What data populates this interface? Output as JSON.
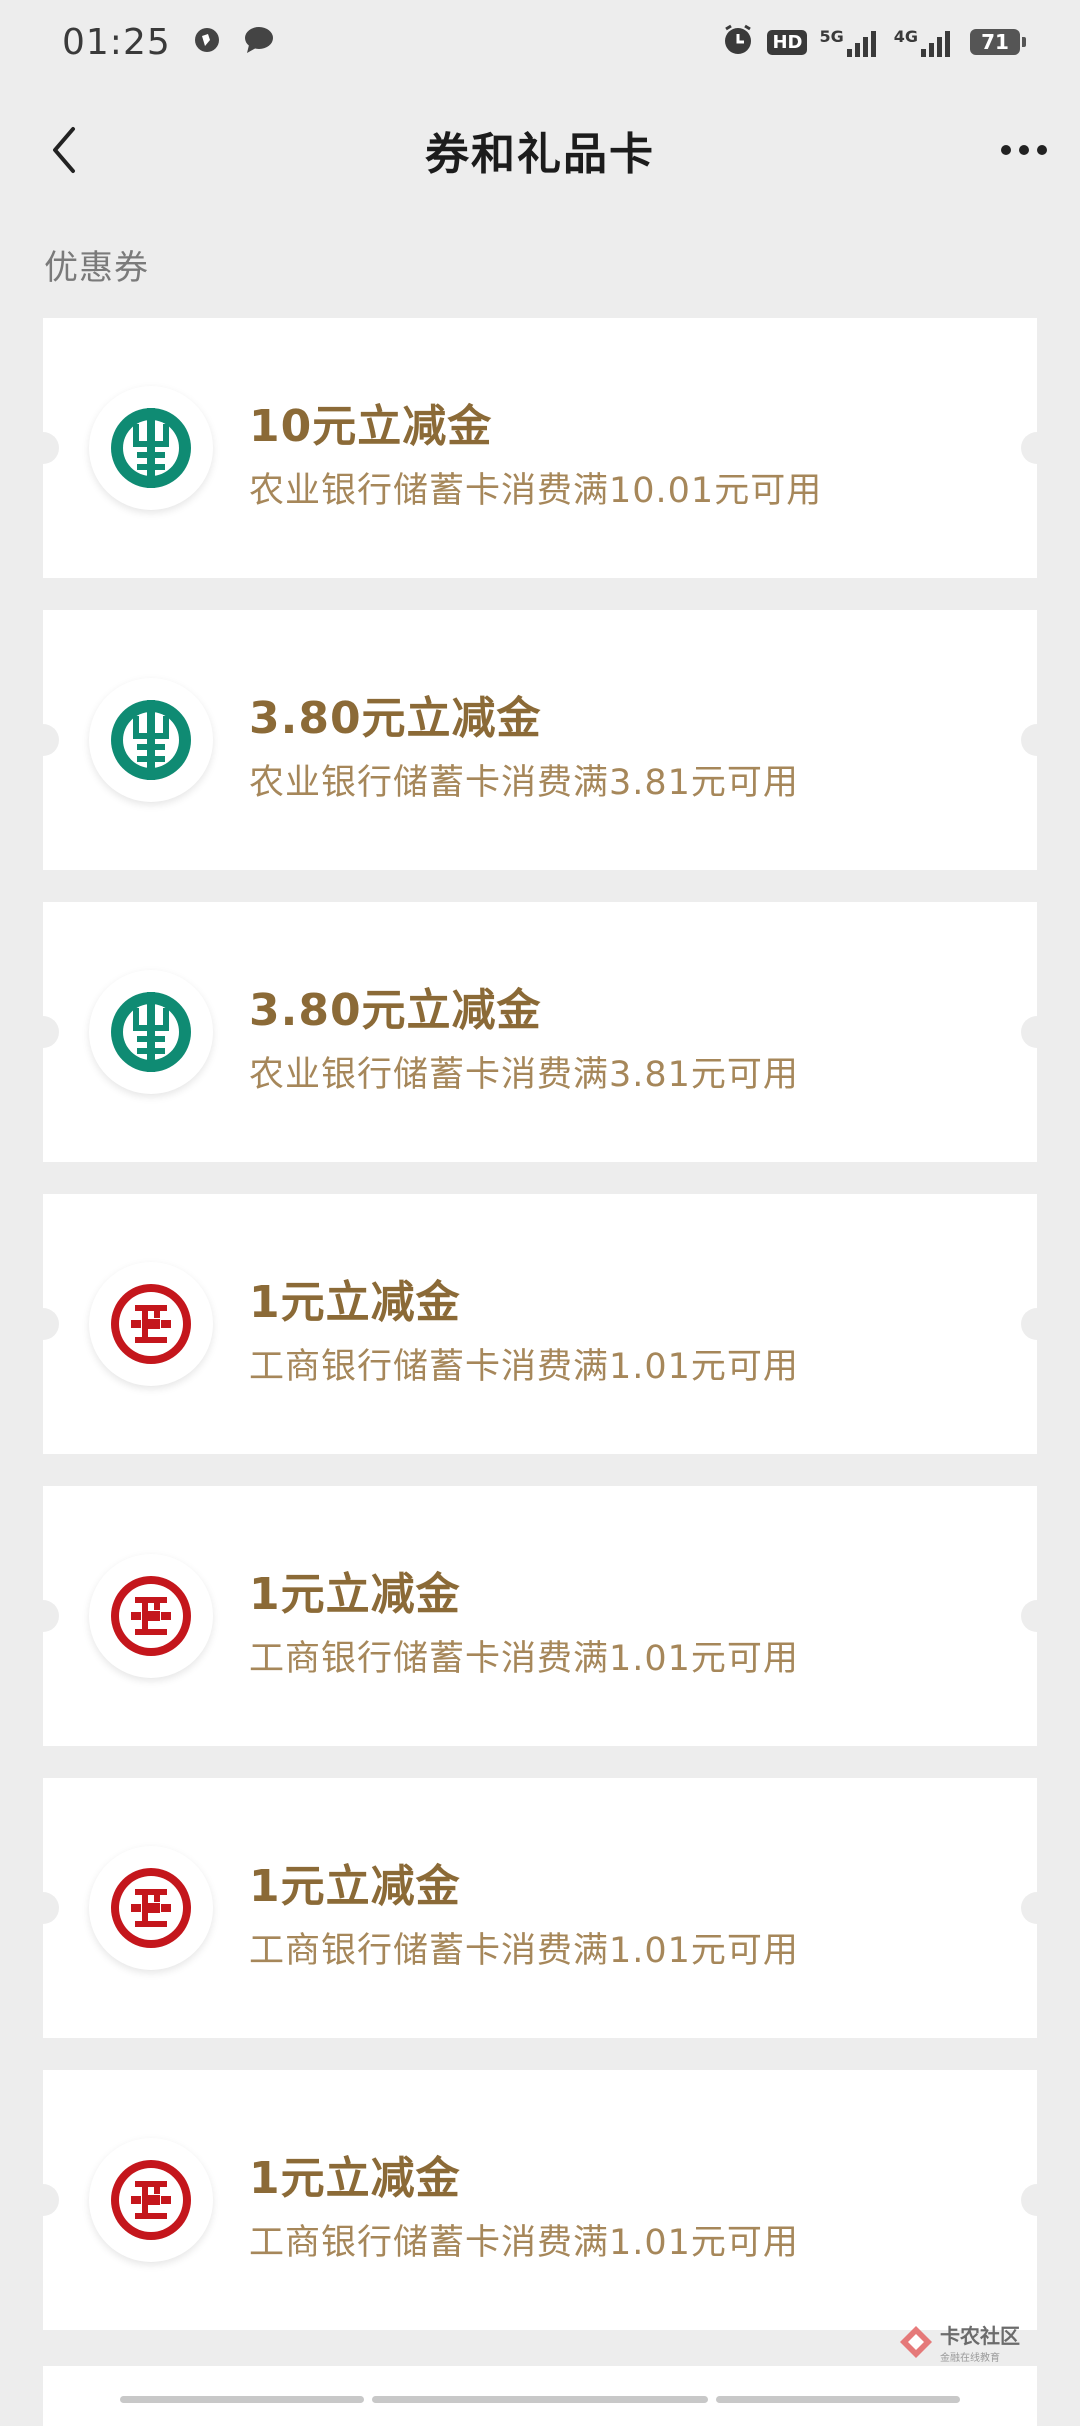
{
  "status_bar": {
    "time": "01:25",
    "hd_label": "HD",
    "net_5g": "5G",
    "net_4g": "4G",
    "battery": "71"
  },
  "nav": {
    "title": "券和礼品卡"
  },
  "section": {
    "label": "优惠券"
  },
  "coupons": [
    {
      "title": "10元立减金",
      "desc": "农业银行储蓄卡消费满10.01元可用",
      "bank": "abc"
    },
    {
      "title": "3.80元立减金",
      "desc": "农业银行储蓄卡消费满3.81元可用",
      "bank": "abc"
    },
    {
      "title": "3.80元立减金",
      "desc": "农业银行储蓄卡消费满3.81元可用",
      "bank": "abc"
    },
    {
      "title": "1元立减金",
      "desc": "工商银行储蓄卡消费满1.01元可用",
      "bank": "icbc"
    },
    {
      "title": "1元立减金",
      "desc": "工商银行储蓄卡消费满1.01元可用",
      "bank": "icbc"
    },
    {
      "title": "1元立减金",
      "desc": "工商银行储蓄卡消费满1.01元可用",
      "bank": "icbc"
    },
    {
      "title": "1元立减金",
      "desc": "工商银行储蓄卡消费满1.01元可用",
      "bank": "icbc"
    }
  ],
  "watermark": {
    "main": "卡农社区",
    "sub": "金融在线教育"
  },
  "colors": {
    "background": "#ededed",
    "coupon_title": "#8b6a37",
    "coupon_desc": "#a6875a",
    "abc_green": "#0f8b73",
    "icbc_red": "#c4161c"
  }
}
